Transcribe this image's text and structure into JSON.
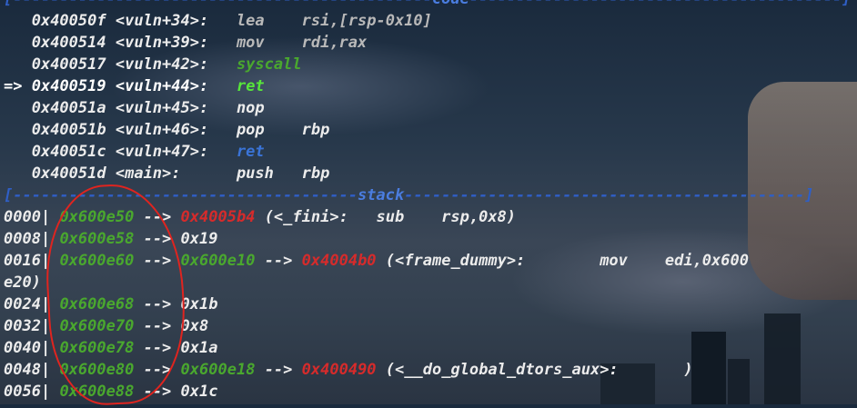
{
  "sections": {
    "code_title": "code",
    "stack_title": "stack"
  },
  "code": [
    {
      "addr": "0x40050f",
      "sym": "<vuln+34>:",
      "op": "lea",
      "args": "rsi,[rsp-0x10]"
    },
    {
      "addr": "0x400514",
      "sym": "<vuln+39>:",
      "op": "mov",
      "args": "rdi,rax"
    },
    {
      "addr": "0x400517",
      "sym": "<vuln+42>:",
      "op": "syscall",
      "args": ""
    },
    {
      "marker": "=>",
      "addr": "0x400519",
      "sym": "<vuln+44>:",
      "op": "ret",
      "args": ""
    },
    {
      "addr": "0x40051a",
      "sym": "<vuln+45>:",
      "op": "nop",
      "args": ""
    },
    {
      "addr": "0x40051b",
      "sym": "<vuln+46>:",
      "op": "pop",
      "args": "rbp"
    },
    {
      "addr": "0x40051c",
      "sym": "<vuln+47>:",
      "op": "ret",
      "args": ""
    },
    {
      "addr": "0x40051d",
      "sym": "<main>:",
      "op": "push",
      "args": "rbp"
    }
  ],
  "stack": [
    {
      "off": "0000|",
      "addr": "0x600e50",
      "arrow": "-->",
      "v1": "0x4005b4",
      "rest": "(<_fini>:   sub    rsp,0x8)"
    },
    {
      "off": "0008|",
      "addr": "0x600e58",
      "arrow": "-->",
      "v1": "0x19"
    },
    {
      "off": "0016|",
      "addr": "0x600e60",
      "arrow": "-->",
      "v1": "0x600e10",
      "arrow2": "-->",
      "v2": "0x4004b0",
      "rest": "(<frame_dummy>:        mov    edi,0x600"
    },
    {
      "wrap": "e20)"
    },
    {
      "off": "0024|",
      "addr": "0x600e68",
      "arrow": "-->",
      "v1": "0x1b"
    },
    {
      "off": "0032|",
      "addr": "0x600e70",
      "arrow": "-->",
      "v1": "0x8"
    },
    {
      "off": "0040|",
      "addr": "0x600e78",
      "arrow": "-->",
      "v1": "0x1a"
    },
    {
      "off": "0048|",
      "addr": "0x600e80",
      "arrow": "-->",
      "v1": "0x600e18",
      "arrow2": "-->",
      "v2": "0x400490",
      "rest": "(<__do_global_dtors_aux>:       )"
    },
    {
      "off": "0056|",
      "addr": "0x600e88",
      "arrow": "-->",
      "v1": "0x1c"
    }
  ]
}
